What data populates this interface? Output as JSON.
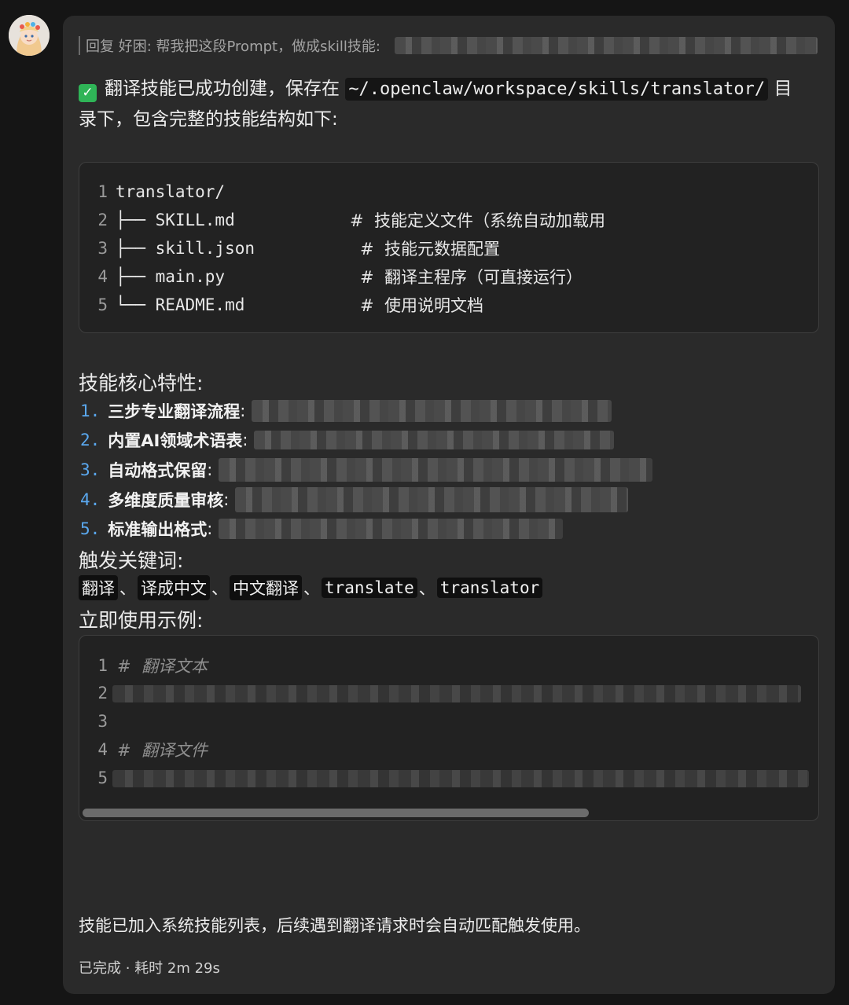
{
  "reply": {
    "label": "回复 好困: 帮我把这段Prompt，做成skill技能:"
  },
  "message": {
    "success_prefix": "翻译技能已成功创建，保存在",
    "path": "~/.openclaw/workspace/skills/translator/",
    "success_suffix_1": "目",
    "success_suffix_2": "录下，包含完整的技能结构如下:"
  },
  "tree": {
    "lines": [
      {
        "num": "1",
        "name": "translator/",
        "comment": ""
      },
      {
        "num": "2",
        "name": "├── SKILL.md",
        "comment": "#  技能定义文件（系统自动加载用"
      },
      {
        "num": "3",
        "name": "├── skill.json",
        "comment": "#  技能元数据配置"
      },
      {
        "num": "4",
        "name": "├── main.py",
        "comment": "#  翻译主程序（可直接运行）"
      },
      {
        "num": "5",
        "name": "└── README.md",
        "comment": "#  使用说明文档"
      }
    ]
  },
  "features": {
    "heading": "技能核心特性:",
    "items": [
      {
        "num": "1.",
        "title": "三步专业翻译流程"
      },
      {
        "num": "2.",
        "title": "内置AI领域术语表"
      },
      {
        "num": "3.",
        "title": "自动格式保留"
      },
      {
        "num": "4.",
        "title": "多维度质量审核"
      },
      {
        "num": "5.",
        "title": "标准输出格式"
      }
    ]
  },
  "keywords": {
    "heading": "触发关键词:",
    "items": [
      "翻译",
      "译成中文",
      "中文翻译",
      "translate",
      "translator"
    ],
    "separator": "、"
  },
  "usage": {
    "heading": "立即使用示例:",
    "lines": [
      {
        "num": "1",
        "text": "#  翻译文本"
      },
      {
        "num": "2",
        "text": ""
      },
      {
        "num": "3",
        "text": ""
      },
      {
        "num": "4",
        "text": "#  翻译文件"
      },
      {
        "num": "5",
        "text": ""
      }
    ]
  },
  "footer": {
    "text": "技能已加入系统技能列表，后续遇到翻译请求时会自动匹配触发使用。",
    "status": "已完成 · 耗时 2m 29s"
  },
  "colors": {
    "accent_blue": "#5aa8ef",
    "check_green": "#2fb457",
    "bubble_bg": "#2a2a2a"
  },
  "icons": {
    "avatar": "avatar-image",
    "success": "check-icon"
  }
}
